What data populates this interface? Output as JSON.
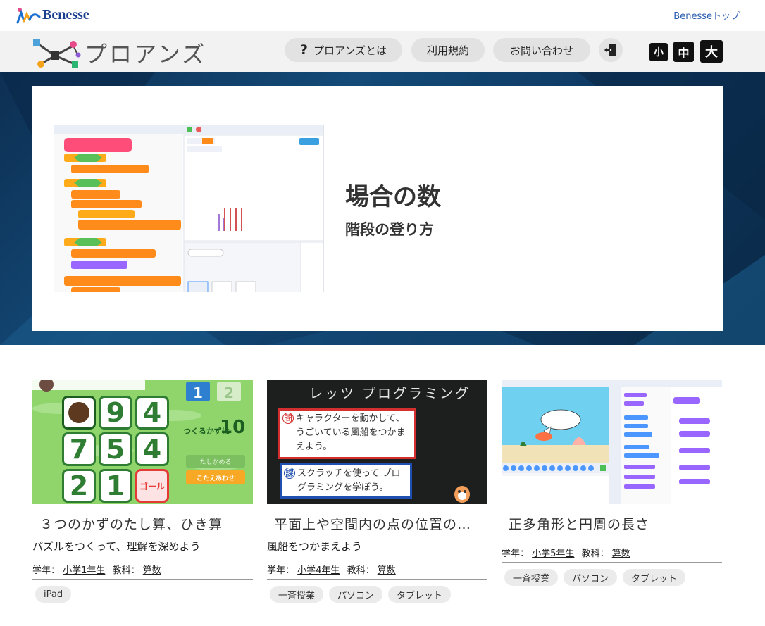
{
  "topbar": {
    "brand": "Benesse",
    "top_link": "Benesseトップ"
  },
  "header": {
    "logo_text": "プロアンズ",
    "nav": [
      {
        "label": "プロアンズとは",
        "icon": "question-icon"
      },
      {
        "label": "利用規約"
      },
      {
        "label": "お問い合わせ"
      }
    ],
    "exit_icon": "exit-door-icon",
    "font_sizes": [
      "小",
      "中",
      "大"
    ]
  },
  "hero": {
    "title": "場合の数",
    "subtitle": "階段の登り方"
  },
  "cards": [
    {
      "title": "３つのかずのたし算、ひき算",
      "subtitle": "パズルをつくって、理解を深めよう",
      "grade_label": "学年：",
      "grade": "小学1年生",
      "subject_label": "教科：",
      "subject": "算数",
      "tags": [
        "iPad"
      ],
      "image": {
        "tiles": [
          "9",
          "4",
          "7",
          "5",
          "4",
          "2",
          "1"
        ],
        "goal": "ゴール",
        "count_label": "つくるかずは",
        "count": "10",
        "check": "たしかめる",
        "answer": "こたえあわせ",
        "level1": "1",
        "level2": "2"
      }
    },
    {
      "title": "平面上や空間内の点の位置の…",
      "subtitle": "風船をつかまえよう",
      "grade_label": "学年：",
      "grade": "小学4年生",
      "subject_label": "教科：",
      "subject": "算数",
      "tags": [
        "一斉授業",
        "パソコン",
        "タブレット"
      ],
      "image": {
        "board_title": "レッツ プログラミング",
        "question_mark": "問",
        "question": "キャラクターを動かして、うごいている風船をつかまえよう。",
        "task_mark": "課",
        "task": "スクラッチを使って プログラミングを学ぼう。"
      }
    },
    {
      "title": "正多角形と円周の長さ",
      "subtitle": "",
      "grade_label": "学年：",
      "grade": "小学5年生",
      "subject_label": "教科：",
      "subject": "算数",
      "tags": [
        "一斉授業",
        "パソコン",
        "タブレット"
      ]
    }
  ],
  "colors": {
    "hero_bg": "#0e3a63",
    "puzzle_green": "#2e7d32",
    "scratch_orange": "#ff8c1a",
    "scratch_green": "#59c059",
    "scratch_purple": "#9966ff"
  }
}
